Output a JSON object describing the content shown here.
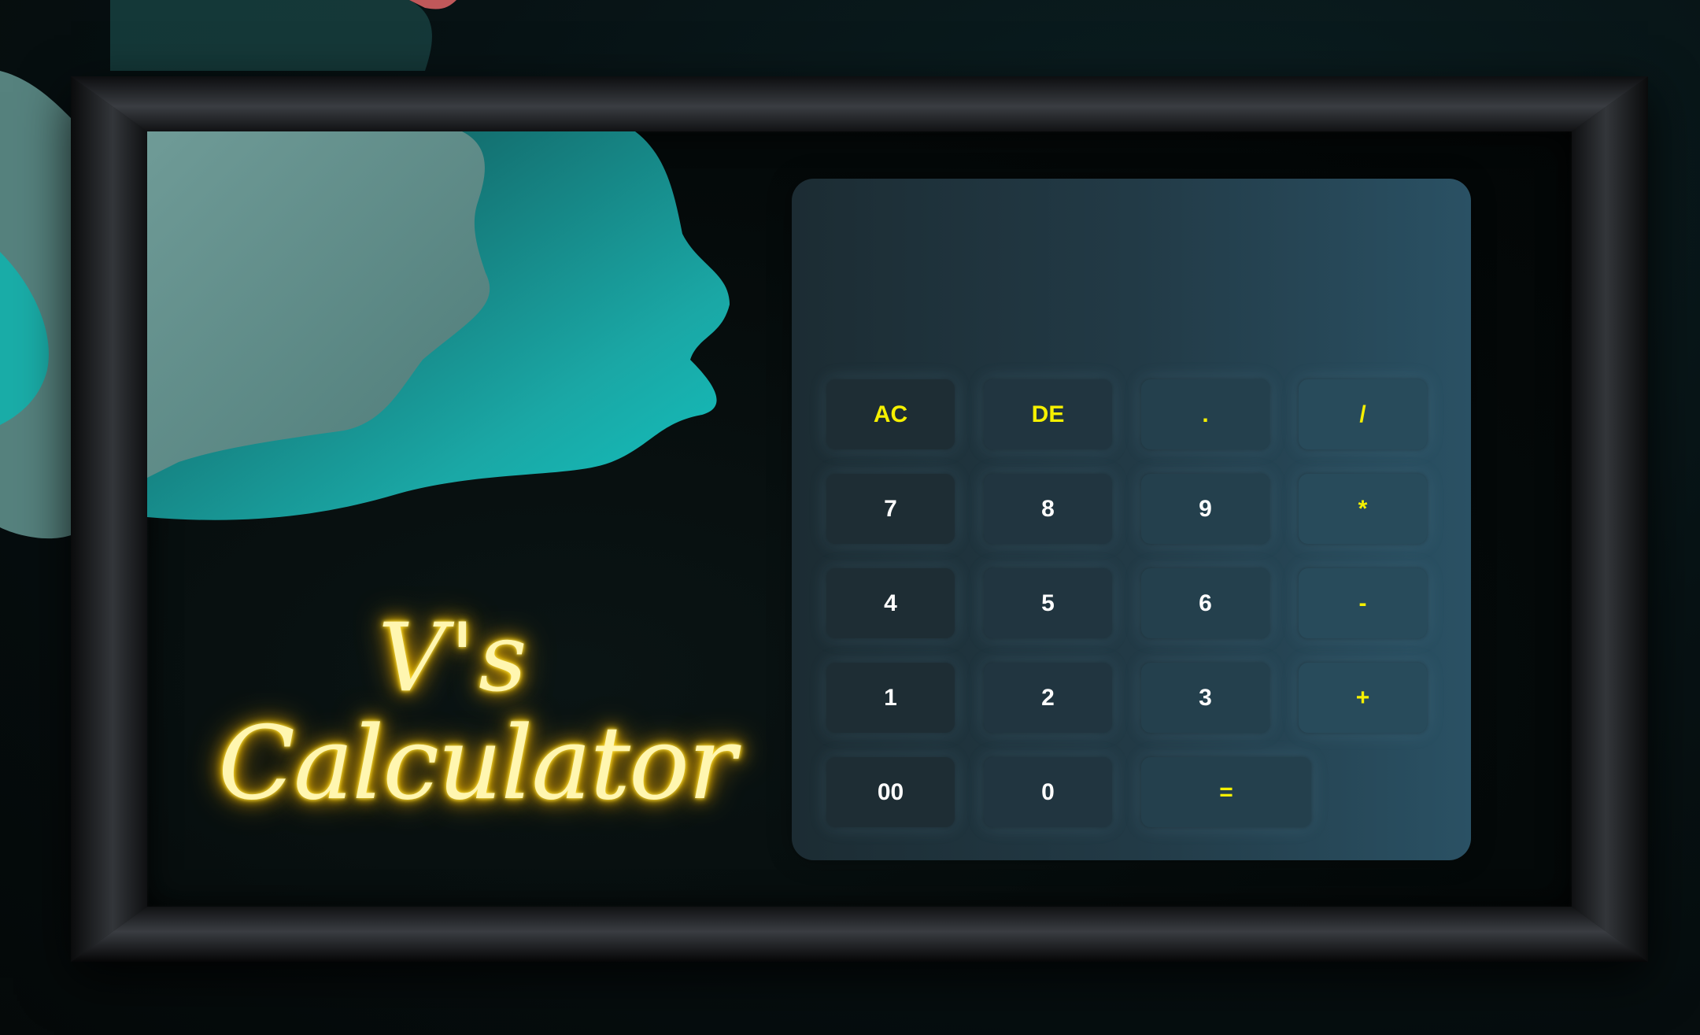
{
  "app": {
    "title_line1": "V's",
    "title_line2": "Calculator"
  },
  "calculator": {
    "display_value": "",
    "keys": [
      {
        "label": "AC",
        "kind": "op"
      },
      {
        "label": "DE",
        "kind": "op"
      },
      {
        "label": ".",
        "kind": "op"
      },
      {
        "label": "/",
        "kind": "op"
      },
      {
        "label": "7",
        "kind": "num"
      },
      {
        "label": "8",
        "kind": "num"
      },
      {
        "label": "9",
        "kind": "num"
      },
      {
        "label": "*",
        "kind": "op"
      },
      {
        "label": "4",
        "kind": "num"
      },
      {
        "label": "5",
        "kind": "num"
      },
      {
        "label": "6",
        "kind": "num"
      },
      {
        "label": "-",
        "kind": "op"
      },
      {
        "label": "1",
        "kind": "num"
      },
      {
        "label": "2",
        "kind": "num"
      },
      {
        "label": "3",
        "kind": "num"
      },
      {
        "label": "+",
        "kind": "op"
      },
      {
        "label": "00",
        "kind": "num"
      },
      {
        "label": "0",
        "kind": "num"
      },
      {
        "label": "=",
        "kind": "op"
      }
    ]
  },
  "colors": {
    "accent_yellow": "#f5f000",
    "key_text_white": "#ffffff",
    "panel_left": "#1c2c33",
    "panel_right": "#2a5164",
    "neon_glow": "#ffd400",
    "teal_wave": "#1aa9a6"
  }
}
